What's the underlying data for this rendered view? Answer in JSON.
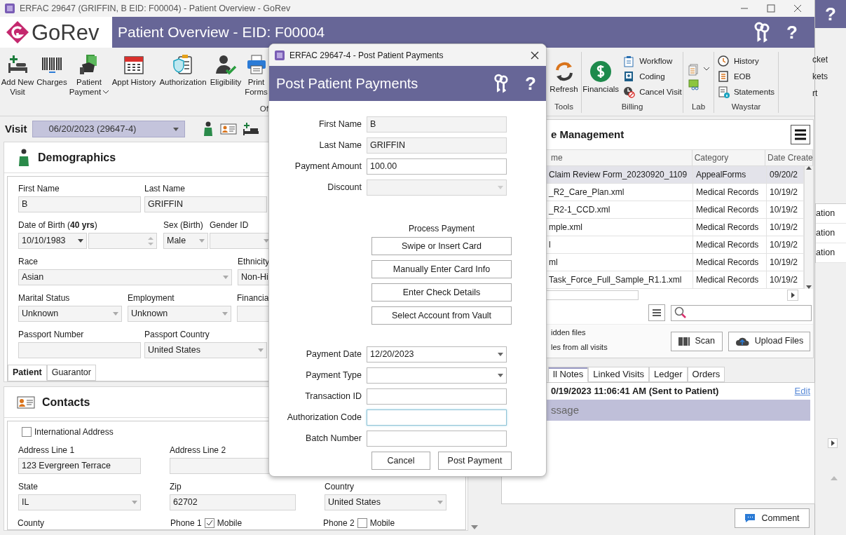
{
  "window": {
    "title": "ERFAC 29647 (GRIFFIN, B EID: F00004) - Patient Overview - GoRev"
  },
  "header": {
    "logo": "GoRev",
    "title": "Patient Overview - EID: F00004",
    "help": "?"
  },
  "toolbar": {
    "left_items": [
      {
        "label": "Add New Visit"
      },
      {
        "label": "Charges"
      },
      {
        "label": "Patient Payment",
        "dropdown": true
      },
      {
        "label": "Appt History"
      },
      {
        "label": "Authorization"
      },
      {
        "label": "Eligibility"
      },
      {
        "label": "Print Forms"
      }
    ],
    "left_group_label": "Of",
    "groups": [
      {
        "label": "Tools",
        "items": [
          {
            "label": "Refresh",
            "kind": "large"
          }
        ]
      },
      {
        "label": "Billing",
        "items": [
          {
            "label": "Financials",
            "kind": "large"
          },
          {
            "label": "Workflow",
            "kind": "small"
          },
          {
            "label": "Coding",
            "kind": "small"
          },
          {
            "label": "Cancel Visit",
            "kind": "small"
          }
        ]
      },
      {
        "label": "Lab",
        "items": [
          {
            "kind": "icon",
            "dropdown": true
          },
          {
            "kind": "icon"
          }
        ]
      },
      {
        "label": "Waystar",
        "items": [
          {
            "label": "History",
            "kind": "small"
          },
          {
            "label": "EOB",
            "kind": "small"
          },
          {
            "label": "Statements",
            "kind": "small"
          }
        ]
      }
    ]
  },
  "visit": {
    "label": "Visit",
    "value": "06/20/2023 (29647-4)"
  },
  "demographics": {
    "title": "Demographics",
    "rows": [
      [
        {
          "label": "First Name",
          "value": "B",
          "kind": "text"
        },
        {
          "label": "Last Name",
          "value": "GRIFFIN",
          "kind": "text"
        }
      ],
      [
        {
          "label": "Date of Birth (**40 yrs**)",
          "value": "10/10/1983",
          "kind": "date"
        },
        {
          "kind": "spin"
        },
        {
          "label": "Sex (Birth)",
          "value": "Male",
          "kind": "select"
        },
        {
          "label": "Gender ID",
          "kind": "select"
        }
      ],
      [
        {
          "label": "Race",
          "value": "Asian",
          "kind": "select"
        },
        {
          "label": "Ethnicity",
          "value": "Non-Hi",
          "kind": "select"
        }
      ],
      [
        {
          "label": "Marital Status",
          "value": "Unknown",
          "kind": "select"
        },
        {
          "label": "Employment",
          "value": "Unknown",
          "kind": "select"
        },
        {
          "label": "Financia",
          "kind": "select"
        }
      ],
      [
        {
          "label": "Passport Number",
          "kind": "text"
        },
        {
          "label": "Passport Country",
          "value": "United States",
          "kind": "select"
        }
      ]
    ],
    "tabs": [
      {
        "label": "Patient",
        "selected": true
      },
      {
        "label": "Guarantor",
        "selected": false
      }
    ]
  },
  "contacts": {
    "title": "Contacts",
    "international": {
      "label": "International Address",
      "checked": false
    },
    "rows": [
      [
        {
          "label": "Address Line 1",
          "value": "123 Evergreen Terrace",
          "kind": "text"
        },
        {
          "label": "Address Line 2",
          "kind": "text"
        }
      ],
      [
        {
          "label": "State",
          "value": "IL",
          "kind": "select"
        },
        {
          "label": "Zip",
          "value": "62702",
          "kind": "text"
        },
        {
          "label": "Country",
          "value": "United States",
          "kind": "select"
        }
      ]
    ],
    "bottom_row": [
      {
        "label": "County"
      },
      {
        "label": "Phone 1",
        "check_label": "Mobile",
        "checked": true
      },
      {
        "label": "Phone 2",
        "check_label": "Mobile",
        "checked": false
      }
    ]
  },
  "documents": {
    "title": "e Management",
    "columns": [
      "me",
      "Category",
      "Date Create"
    ],
    "rows": [
      {
        "name": "Claim Review Form_20230920_1109",
        "category": "AppealForms",
        "date": "09/20/2",
        "selected": true
      },
      {
        "name": "_R2_Care_Plan.xml",
        "category": "Medical Records",
        "date": "10/19/2",
        "selected": false
      },
      {
        "name": "_R2-1_CCD.xml",
        "category": "Medical Records",
        "date": "10/19/2",
        "selected": false
      },
      {
        "name": "mple.xml",
        "category": "Medical Records",
        "date": "10/19/2",
        "selected": false
      },
      {
        "name": "l",
        "category": "Medical Records",
        "date": "10/19/2",
        "selected": false
      },
      {
        "name": "ml",
        "category": "Medical Records",
        "date": "10/19/2",
        "selected": false
      },
      {
        "name": "Task_Force_Full_Sample_R1.1.xml",
        "category": "Medical Records",
        "date": "10/19/2",
        "selected": false
      }
    ],
    "options": [
      "idden files",
      "les from all visits"
    ],
    "scan": "Scan",
    "upload": "Upload Files"
  },
  "notes": {
    "tabs": [
      {
        "label": "ll Notes",
        "selected": true
      },
      {
        "label": "Linked Visits",
        "selected": false
      },
      {
        "label": "Ledger",
        "selected": false
      },
      {
        "label": "Orders",
        "selected": false
      }
    ],
    "entry": "0/19/2023 11:06:41 AM (Sent to Patient)",
    "edit": "Edit",
    "message": "ssage",
    "comment": "Comment"
  },
  "back_window": {
    "help": "?",
    "items": [
      "cket",
      "kets",
      "rt"
    ],
    "rows": [
      "ation",
      "ation",
      "ation"
    ]
  },
  "dialog": {
    "title": "ERFAC 29647-4 - Post Patient Payments",
    "heading": "Post Patient Payments",
    "help": "?",
    "fields_top": [
      {
        "label": "First Name",
        "value": "B",
        "kind": "text",
        "readonly": true,
        "focused": false
      },
      {
        "label": "Last Name",
        "value": "GRIFFIN",
        "kind": "text",
        "readonly": true,
        "focused": false
      },
      {
        "label": "Payment Amount",
        "value": "100.00",
        "kind": "text",
        "readonly": false,
        "focused": false
      },
      {
        "label": "Discount",
        "kind": "select",
        "readonly": true,
        "focused": false
      }
    ],
    "process_label": "Process Payment",
    "process_buttons": [
      "Swipe or Insert Card",
      "Manually Enter Card Info",
      "Enter Check Details",
      "Select Account from Vault"
    ],
    "fields_bottom": [
      {
        "label": "Payment Date",
        "value": "12/20/2023",
        "kind": "select",
        "readonly": false,
        "focused": false
      },
      {
        "label": "Payment Type",
        "kind": "select",
        "readonly": false,
        "focused": false
      },
      {
        "label": "Transaction ID",
        "kind": "text",
        "readonly": false,
        "focused": false
      },
      {
        "label": "Authorization Code",
        "kind": "text",
        "readonly": false,
        "focused": true
      },
      {
        "label": "Batch Number",
        "kind": "text",
        "readonly": false,
        "focused": false
      }
    ],
    "buttons": [
      "Cancel",
      "Post Payment"
    ]
  }
}
